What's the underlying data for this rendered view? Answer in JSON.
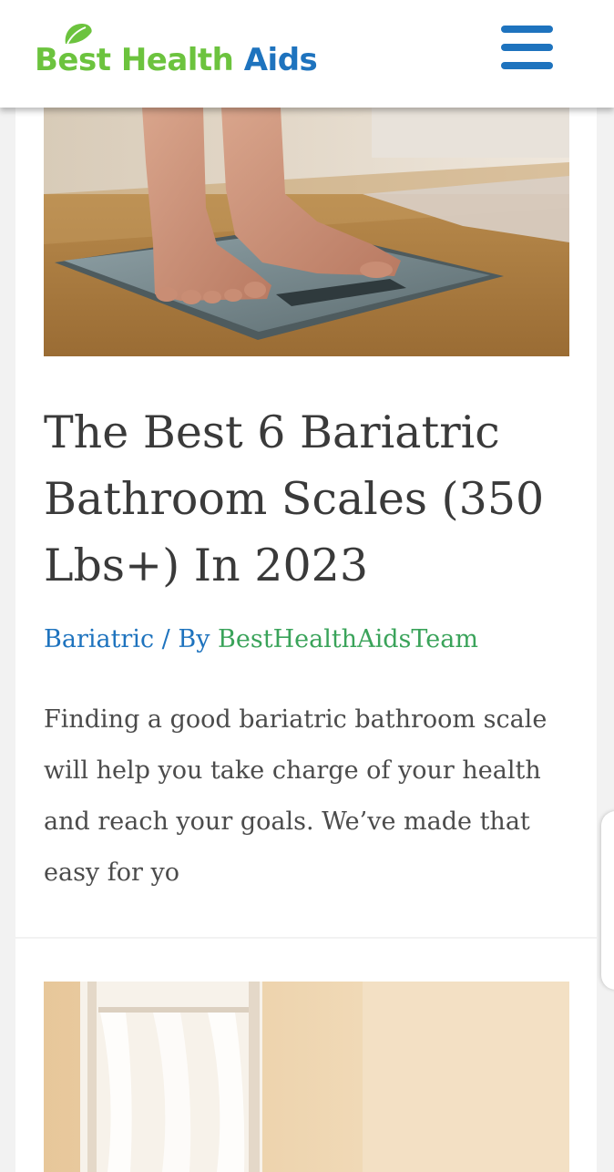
{
  "header": {
    "logo_best": "Best",
    "logo_health": "Health",
    "logo_aids": "Aids"
  },
  "post": {
    "title": "The Best 6 Bariatric Bathroom Scales (350 Lbs+) In 2023",
    "category": "Bariatric",
    "separator": " / By ",
    "author": "BestHealthAidsTeam",
    "excerpt": "Finding a good bariatric bathroom scale will help you take charge of your health and reach your goals. We’ve made that easy for yo"
  },
  "colors": {
    "brand_green": "#6cc33e",
    "brand_blue": "#1e73be",
    "author_green": "#3aa35a",
    "text": "#3a3a3a"
  },
  "icons": {
    "menu": "hamburger-menu-icon",
    "logo_leaf": "leaf-icon"
  }
}
